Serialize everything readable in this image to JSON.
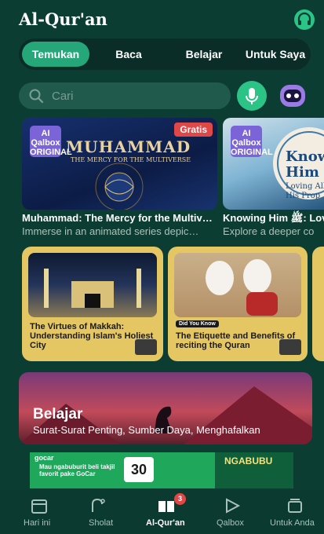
{
  "header": {
    "title": "Al-Qur'an",
    "headset_icon": "headset-icon"
  },
  "tabs": [
    {
      "label": "Temukan",
      "active": true
    },
    {
      "label": "Baca",
      "active": false
    },
    {
      "label": "Belajar",
      "active": false
    },
    {
      "label": "Untuk Saya",
      "active": false
    }
  ],
  "search": {
    "placeholder": "Cari",
    "value": ""
  },
  "featured": [
    {
      "badge": "Gratis",
      "logo": "AI Qalbox ORIGINAL",
      "art_title": "MUHAMMAD",
      "art_subtitle": "THE MERCY FOR THE MULTIVERSE",
      "title": "Muhammad: The Mercy for the Multiv…",
      "subtitle": "Immerse in an animated series depic…"
    },
    {
      "logo": "AI Qalbox ORIGINAL",
      "art_title": "Know Him",
      "art_subtitle": "Loving All His Prop",
      "title": "Knowing Him ﷺ: Lov",
      "subtitle": "Explore a deeper co"
    }
  ],
  "articles": [
    {
      "caption": "The Virtues of Makkah: Understanding Islam's Holiest City"
    },
    {
      "tag": "Did You Know",
      "caption": "The Etiquette and Benefits of reciting the Quran"
    }
  ],
  "banner": {
    "title": "Belajar",
    "subtitle": "Surat-Surat Penting, Sumber Daya, Menghafalkan"
  },
  "ad": {
    "brand": "gocar",
    "text": "Mau ngabuburit beli takjil favorit pake GoCar",
    "amount": "30",
    "right_text": "NGABUBU"
  },
  "nav": [
    {
      "label": "Hari ini",
      "icon": "calendar-icon",
      "active": false
    },
    {
      "label": "Sholat",
      "icon": "prayer-icon",
      "active": false
    },
    {
      "label": "Al-Qur'an",
      "icon": "quran-book-icon",
      "active": true,
      "badge": "3"
    },
    {
      "label": "Qalbox",
      "icon": "play-icon",
      "active": false
    },
    {
      "label": "Untuk Anda",
      "icon": "stack-icon",
      "active": false
    }
  ],
  "colors": {
    "background": "#0c3d33",
    "accent": "#25a779",
    "badge": "#e04848"
  }
}
